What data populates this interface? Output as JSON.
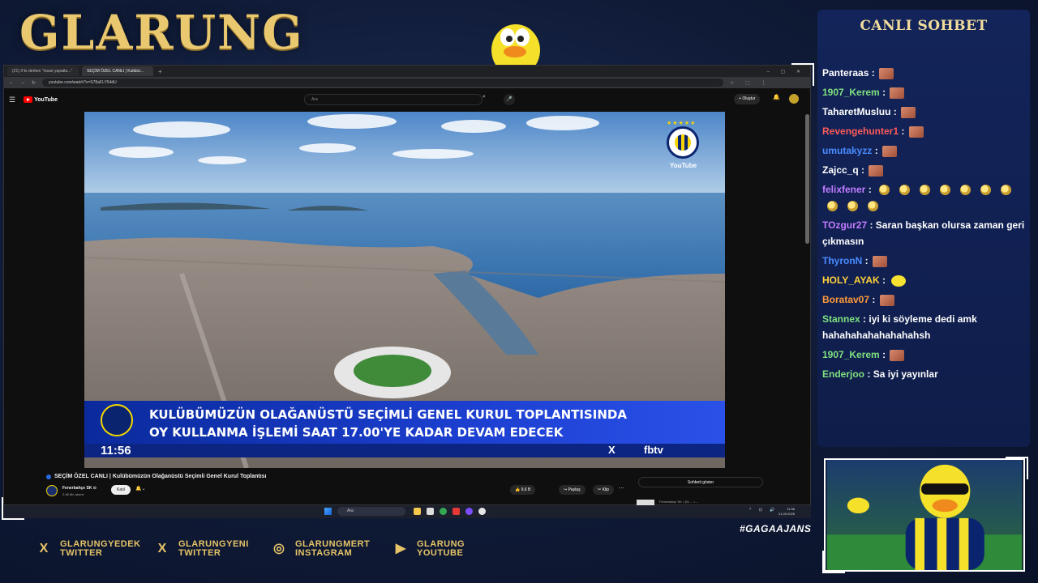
{
  "overlay": {
    "logo": "GLARUNG",
    "hashtag": "#GAGAAJANS",
    "chat_title": "CANLI SOHBET",
    "socials": [
      {
        "icon": "x-icon",
        "glyph": "X",
        "line1": "GLARUNGYEDEK",
        "line2": "TWITTER"
      },
      {
        "icon": "x-icon",
        "glyph": "X",
        "line1": "GLARUNGYENI",
        "line2": "TWITTER"
      },
      {
        "icon": "instagram-icon",
        "glyph": "◎",
        "line1": "GLARUNGMERT",
        "line2": "INSTAGRAM"
      },
      {
        "icon": "youtube-icon",
        "glyph": "▶",
        "line1": "GLARUNG",
        "line2": "YOUTUBE"
      }
    ]
  },
  "browser": {
    "tabs": [
      {
        "label": "(21) X'te derken \"insan yapatta...\""
      },
      {
        "label": "SEÇİM ÖZEL CANLI | Kulübü..."
      }
    ],
    "url": "youtube.com/watch?v=S78aFLY54dU"
  },
  "youtube": {
    "logo_text": "YouTube",
    "search_placeholder": "Ara",
    "create_label": "Oluştur",
    "video": {
      "lower_third_line1": "KULÜBÜMÜZÜN OLAĞANÜSTÜ SEÇİMLİ GENEL KURUL TOPLANTISINDA",
      "lower_third_line2": "OY KULLANMA İŞLEMİ SAAT 17.00'YE KADAR DEVAM EDECEK",
      "clock": "11:56",
      "social_x": "X",
      "channel_tag": "fbtv",
      "corner_logo_text": "YouTube",
      "stars": "★★★★★"
    },
    "title": "SEÇİM ÖZEL CANLI | Kulübümüzün Olağanüstü Seçimli Genel Kurul Toplantısı",
    "channel_name": "Fenerbahçe SK ⊙",
    "channel_subs": "2,98 Mn abone",
    "join_label": "Katıl",
    "likes": "👍 9,6 B",
    "share_label": "↪ Paylaş",
    "clip_label": "✂ Klip",
    "chat_show_label": "Sohbeti göster",
    "related_title": "Fenerbahçe SK • ŞU ... • ..."
  },
  "taskbar": {
    "search_placeholder": "Ara",
    "time": "11:56",
    "date": "21.09.2025"
  },
  "chat": {
    "messages": [
      {
        "user": "Panteraas",
        "color": "#ffffff",
        "text": "",
        "emotes": [
          "emote"
        ]
      },
      {
        "user": "1907_Kerem",
        "color": "#7fe07f",
        "text": "",
        "emotes": [
          "emote"
        ]
      },
      {
        "user": "TaharetMusluu",
        "color": "#ffffff",
        "text": "",
        "emotes": [
          "emote"
        ]
      },
      {
        "user": "Revengehunter1",
        "color": "#ff5a5a",
        "text": "",
        "emotes": [
          "emote"
        ]
      },
      {
        "user": "umutakyzz",
        "color": "#4a8cff",
        "text": "",
        "emotes": [
          "emote"
        ]
      },
      {
        "user": "Zajcc_q",
        "color": "#ffffff",
        "text": "",
        "emotes": [
          "emote"
        ]
      },
      {
        "user": "felixfener",
        "color": "#c07cff",
        "text": "",
        "emotes": [
          "round",
          "round",
          "round",
          "round",
          "round",
          "round",
          "round",
          "round",
          "round",
          "round"
        ]
      },
      {
        "user": "TOzgur27",
        "color": "#c07cff",
        "text": "Saran başkan olursa zaman geri çıkmasın",
        "emotes": []
      },
      {
        "user": "ThyronN",
        "color": "#4a8cff",
        "text": "",
        "emotes": [
          "emote"
        ]
      },
      {
        "user": "HOLY_AYAK",
        "color": "#ffd23a",
        "text": "",
        "emotes": [
          "bird"
        ]
      },
      {
        "user": "Boratav07",
        "color": "#ff9a3a",
        "text": "",
        "emotes": [
          "emote"
        ]
      },
      {
        "user": "Stannex",
        "color": "#7fe07f",
        "text": "iyi ki söyleme dedi amk hahahahahahahahahsh",
        "emotes": []
      },
      {
        "user": "1907_Kerem",
        "color": "#7fe07f",
        "text": "",
        "emotes": [
          "emote"
        ]
      },
      {
        "user": "Enderjoo",
        "color": "#7fe07f",
        "text": "Sa iyi yayınlar",
        "emotes": []
      }
    ]
  }
}
